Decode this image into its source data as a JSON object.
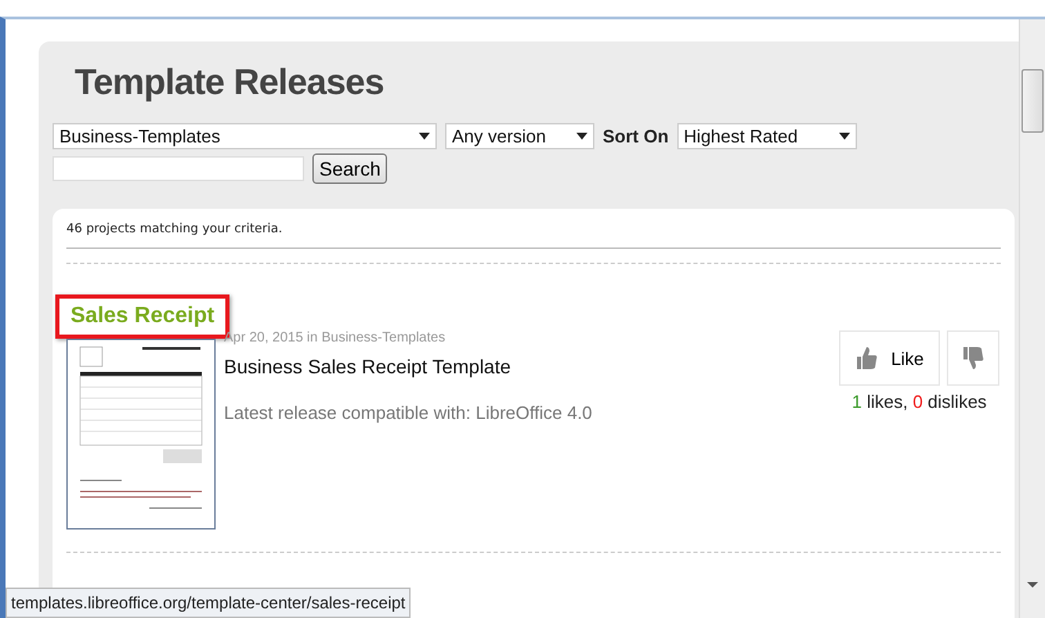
{
  "page_title": "Template Releases",
  "filters": {
    "category": "Business-Templates",
    "version": "Any version",
    "sort_label": "Sort On",
    "sort": "Highest Rated",
    "search_button": "Search"
  },
  "results": {
    "count_text": "46 projects matching your criteria.",
    "items": [
      {
        "title": "Sales Receipt",
        "highlighted": true,
        "meta": "Apr 20, 2015 in Business-Templates",
        "name": "Business Sales Receipt Template",
        "compat": "Latest release compatible with: LibreOffice 4.0",
        "like_button": "Like",
        "likes": "1",
        "likes_label": "likes,",
        "dislikes": "0",
        "dislikes_label": "dislikes"
      }
    ]
  },
  "status_bar": {
    "url": "templates.libreoffice.org/template-center/sales-receipt"
  }
}
